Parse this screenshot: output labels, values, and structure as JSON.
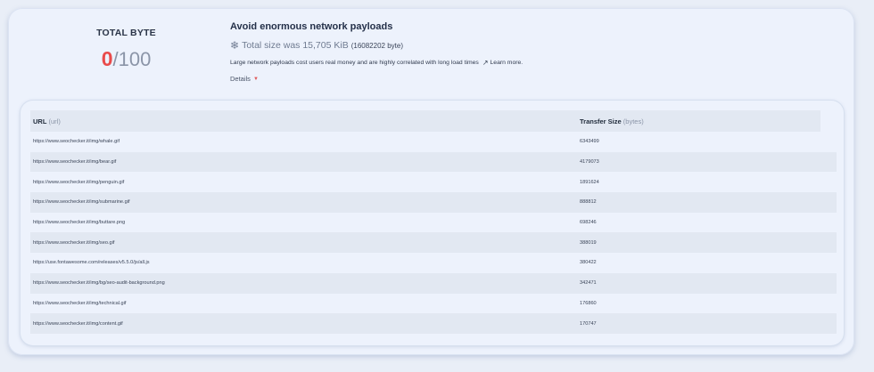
{
  "audit": {
    "score_title": "TOTAL BYTE",
    "score_value": "0",
    "score_max": "/100",
    "title": "Avoid enormous network payloads",
    "size_text": "Total size was 15,705 KiB",
    "size_bytes": "(16082202 byte)",
    "description": "Large network payloads cost users real money and are highly correlated with long load times",
    "learn_more": "Learn more.",
    "details_label": "Details",
    "icons": {
      "size": "snowflake-icon",
      "learn_more": "external-link-icon",
      "details": "caret-down-icon"
    },
    "colors": {
      "score": "#e94b4b",
      "caret": "#e05a5a"
    }
  },
  "table": {
    "headers": {
      "url": "URL",
      "url_key": "(url)",
      "size": "Transfer Size",
      "size_unit": "(bytes)"
    },
    "rows": [
      {
        "url": "https://www.seochecker.it/img/whale.gif",
        "size": "6343499"
      },
      {
        "url": "https://www.seochecker.it/img/bear.gif",
        "size": "4179073"
      },
      {
        "url": "https://www.seochecker.it/img/penguin.gif",
        "size": "1891624"
      },
      {
        "url": "https://www.seochecker.it/img/submarine.gif",
        "size": "888812"
      },
      {
        "url": "https://www.seochecker.it/img/buttare.png",
        "size": "698246"
      },
      {
        "url": "https://www.seochecker.it/img/seo.gif",
        "size": "388019"
      },
      {
        "url": "https://use.fontawesome.com/releases/v5.5.0/js/all.js",
        "size": "380422"
      },
      {
        "url": "https://www.seochecker.it/img/bg/seo-audit-background.png",
        "size": "342471"
      },
      {
        "url": "https://www.seochecker.it/img/technical.gif",
        "size": "176860"
      },
      {
        "url": "https://www.seochecker.it/img/content.gif",
        "size": "170747"
      }
    ]
  }
}
